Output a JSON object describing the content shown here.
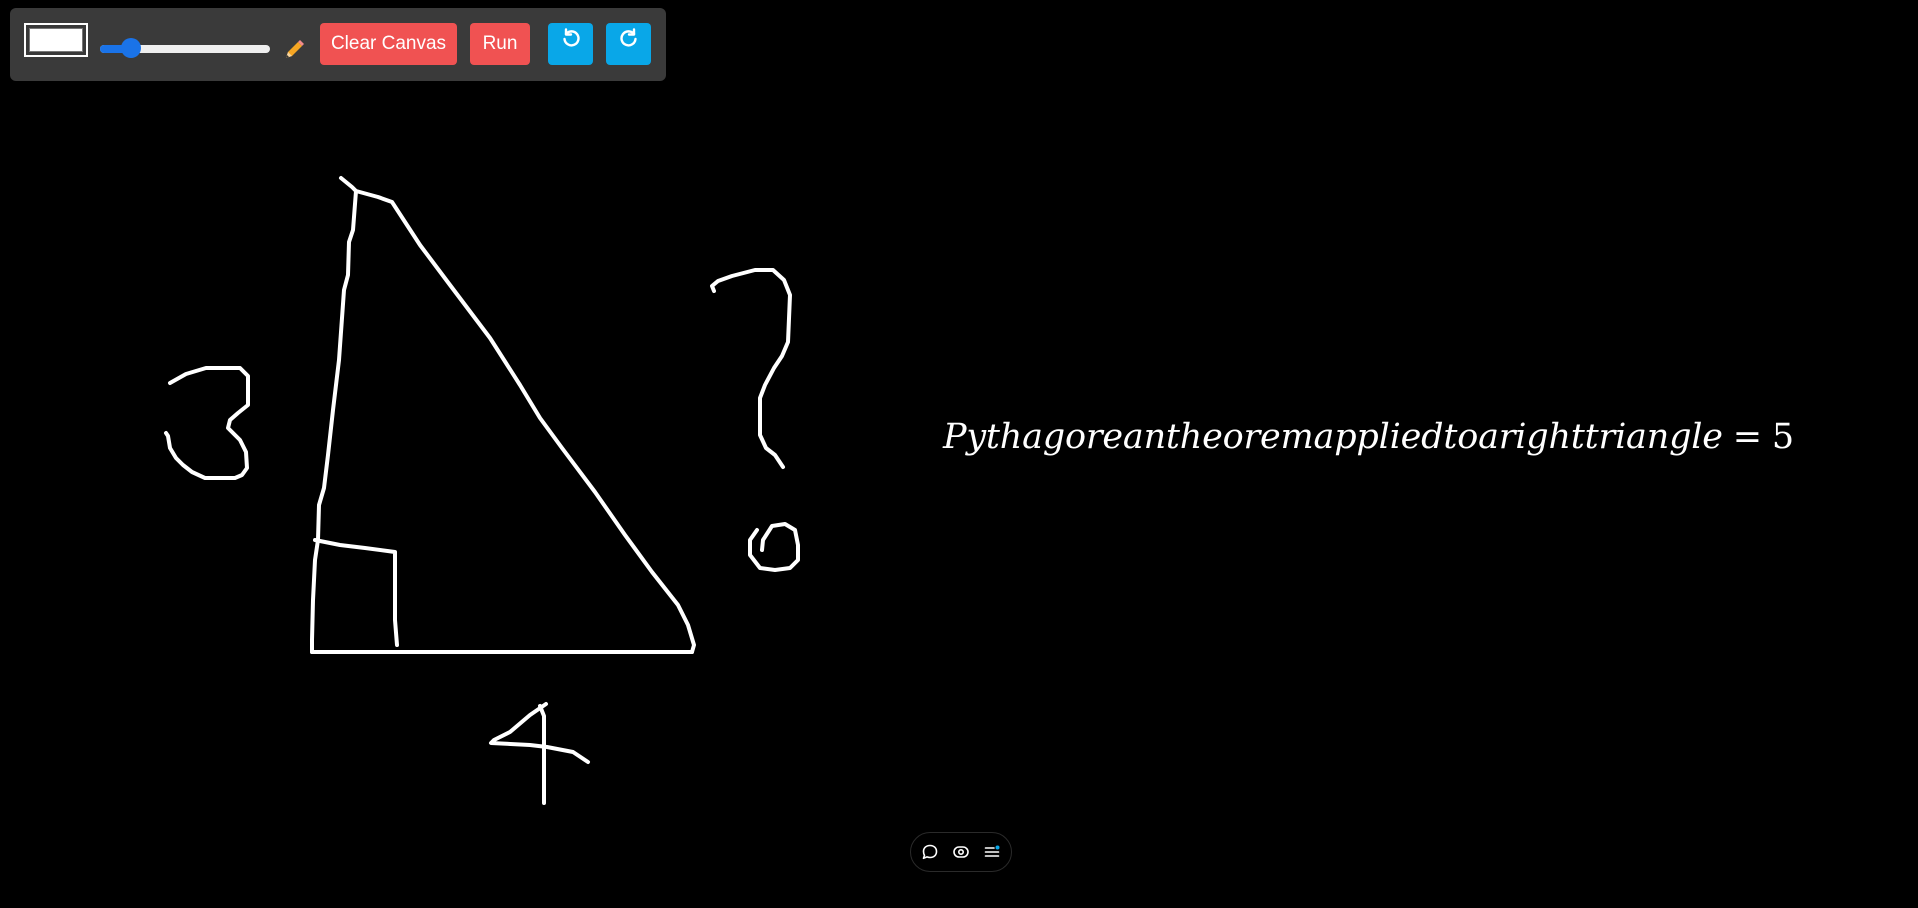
{
  "toolbar": {
    "color_value": "#ffffff",
    "brush_size_fraction": 0.18,
    "clear_label": "Clear Canvas",
    "run_label": "Run",
    "undo_icon": "undo-icon",
    "redo_icon": "redo-icon",
    "pencil_icon": "pencil-icon"
  },
  "result": {
    "expression": "Pythagoreantheoremappliedtoarighttriangle",
    "equals": "=",
    "value": "5"
  },
  "floating_bar": {
    "icons": [
      "comment-icon",
      "eye-icon",
      "menu-icon"
    ]
  },
  "colors": {
    "background": "#000000",
    "toolbar": "#3a3a3a",
    "danger": "#f05252",
    "primary": "#09a7e8",
    "slider": "#1a73e8",
    "stroke": "#ffffff"
  }
}
